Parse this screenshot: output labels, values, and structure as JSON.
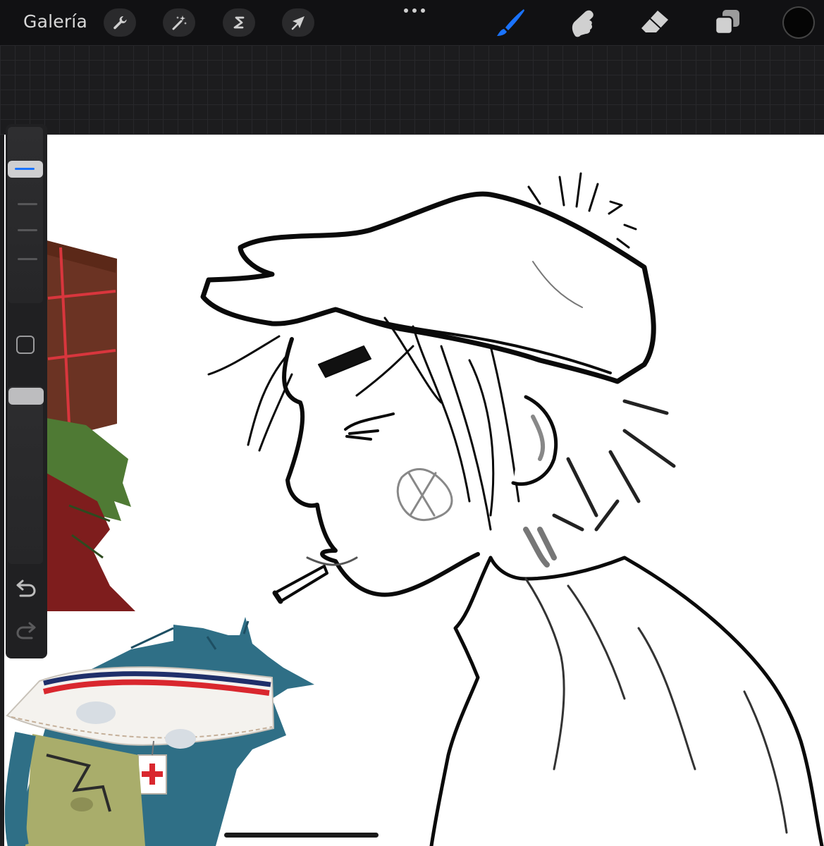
{
  "toolbar": {
    "gallery_label": "Galería",
    "left_tools": [
      {
        "name": "actions",
        "icon": "wrench-icon"
      },
      {
        "name": "adjustments",
        "icon": "magic-wand-icon"
      },
      {
        "name": "selection",
        "icon": "selection-s-icon"
      },
      {
        "name": "transform",
        "icon": "arrow-cursor-icon"
      }
    ],
    "more_icon": "more-dots-icon",
    "right_tools": [
      {
        "name": "paint",
        "icon": "brush-icon",
        "active": true
      },
      {
        "name": "smudge",
        "icon": "smudge-finger-icon"
      },
      {
        "name": "erase",
        "icon": "eraser-icon"
      },
      {
        "name": "layers",
        "icon": "layers-icon"
      }
    ],
    "current_color": "#050505"
  },
  "sidebar": {
    "brush_size_icon": "brush-size-slider",
    "modify_icon": "square-modify-icon",
    "opacity_icon": "opacity-slider",
    "undo_icon": "undo-arrow-icon",
    "redo_icon": "redo-arrow-icon"
  },
  "colors": {
    "accent": "#1a73ff",
    "toolbar_bg": "#111113",
    "canvas_bg": "#ffffff"
  }
}
